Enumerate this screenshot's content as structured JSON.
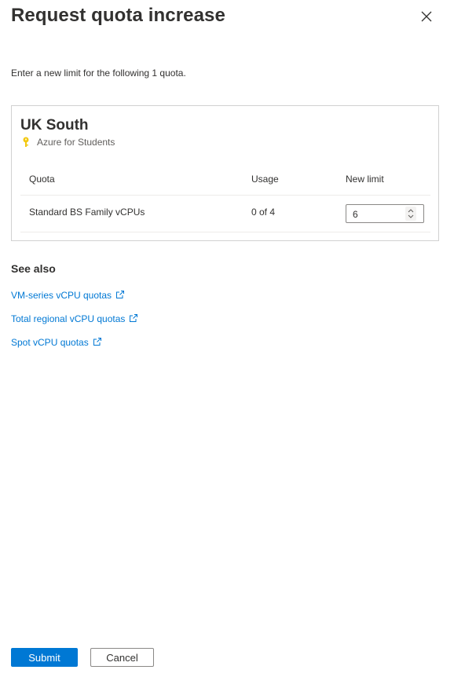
{
  "panel": {
    "title": "Request quota increase",
    "intro": "Enter a new limit for the following 1 quota."
  },
  "card": {
    "region": "UK South",
    "subscription": "Azure for Students",
    "columns": {
      "quota": "Quota",
      "usage": "Usage",
      "new_limit": "New limit"
    },
    "rows": [
      {
        "quota": "Standard BS Family vCPUs",
        "usage": "0 of 4",
        "new_limit": "6"
      }
    ]
  },
  "see_also": {
    "heading": "See also",
    "links": [
      "VM-series vCPU quotas",
      "Total regional vCPU quotas",
      "Spot vCPU quotas"
    ]
  },
  "footer": {
    "submit_label": "Submit",
    "cancel_label": "Cancel"
  },
  "colors": {
    "accent": "#0078d4",
    "key_icon": "#f2c811",
    "border": "#d1d1d1"
  },
  "icons": {
    "close": "close-icon",
    "subscription": "key-icon",
    "external": "external-link-icon",
    "stepper": "chevron-up-down-icon"
  }
}
